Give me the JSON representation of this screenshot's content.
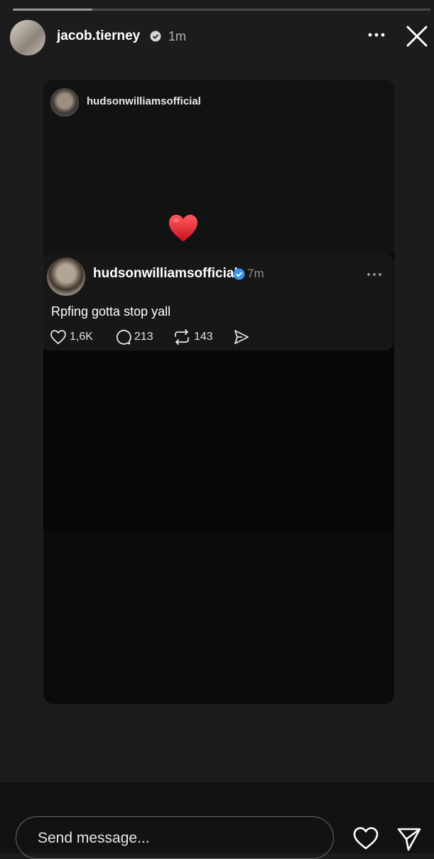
{
  "story": {
    "progress": 0.19,
    "username": "jacob.tierney",
    "time": "1m",
    "verified": true
  },
  "shared_post": {
    "username": "hudsonwilliamsofficial",
    "emoji": "heart"
  },
  "thread": {
    "username": "hudsonwilliamsofficial",
    "verified": true,
    "time": "7m",
    "text": "Rpfing gotta stop yall",
    "likes": "1,6K",
    "replies": "213",
    "reposts": "143"
  },
  "message_bar": {
    "placeholder": "Send message..."
  },
  "colors": {
    "background": "#1c1c1e",
    "verified_blue": "#3897f0",
    "heart_red": "#e0202c"
  }
}
